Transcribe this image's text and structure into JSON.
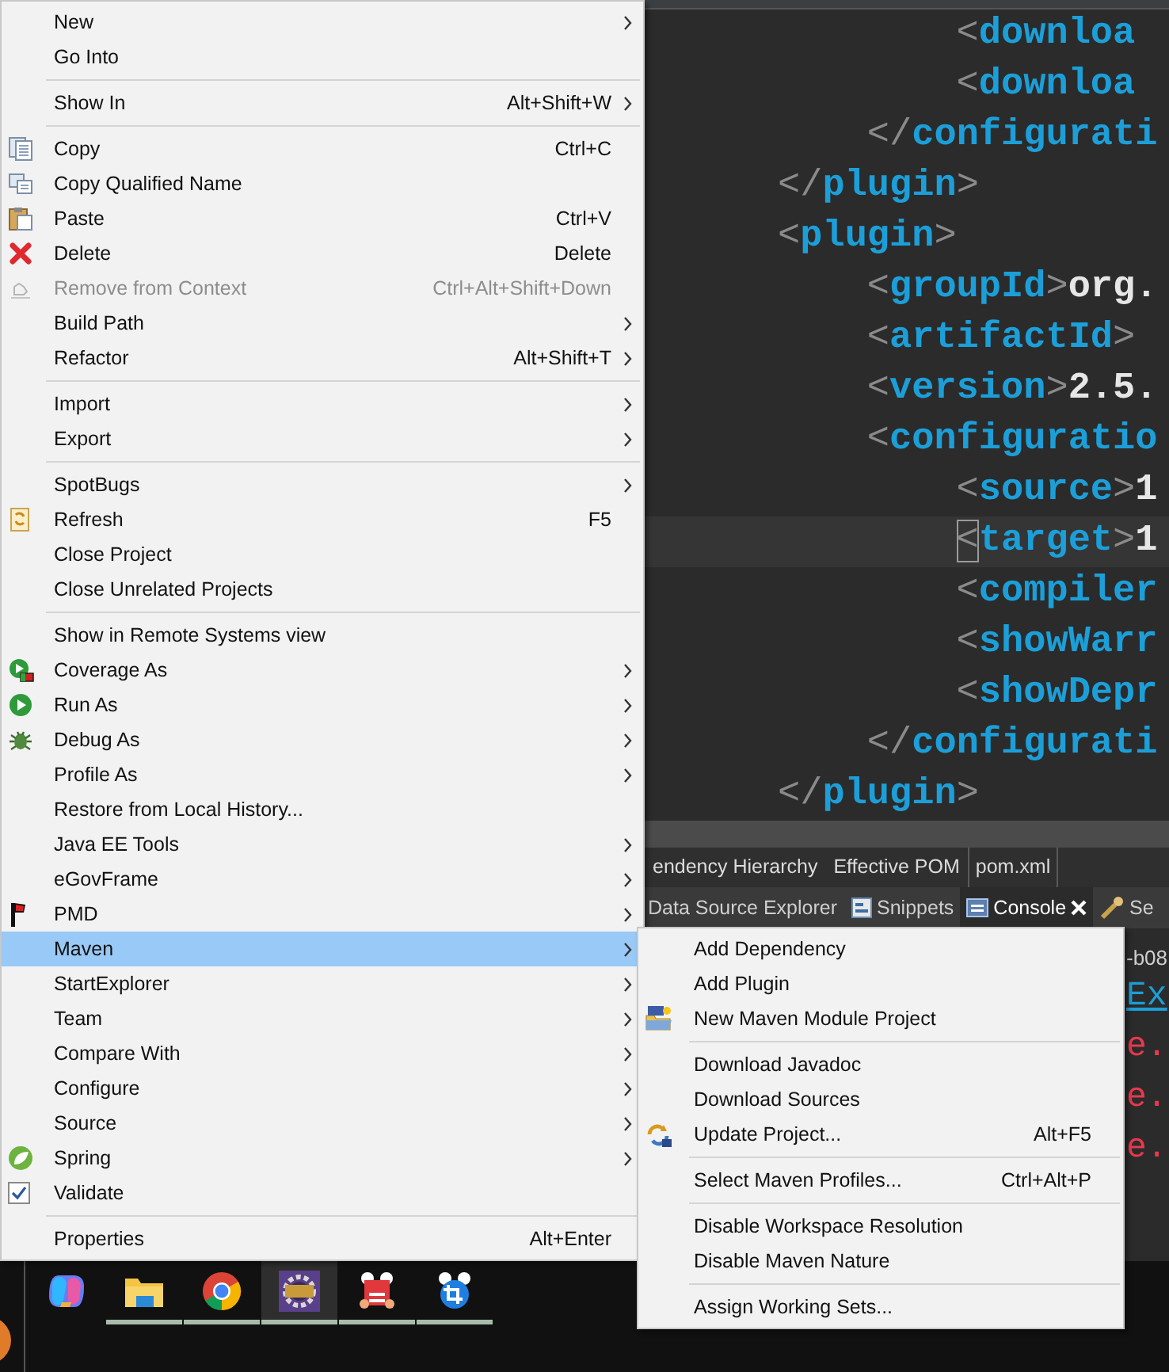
{
  "editor": {
    "lines": [
      {
        "text": "        <downloa",
        "current": false
      },
      {
        "text": "        <downloa",
        "current": false
      },
      {
        "text": "    </configurati",
        "current": false
      },
      {
        "text": "</plugin>",
        "current": false
      },
      {
        "text": "<plugin>",
        "current": false
      },
      {
        "text": "    <groupId>org.",
        "current": false
      },
      {
        "text": "    <artifactId>",
        "current": false
      },
      {
        "text": "    <version>2.5.",
        "current": false
      },
      {
        "text": "    <configuratio",
        "current": false
      },
      {
        "text": "        <source>1",
        "current": false
      },
      {
        "text": "        <target>1",
        "current": true
      },
      {
        "text": "        <compiler",
        "current": false
      },
      {
        "text": "        <showWarr",
        "current": false
      },
      {
        "text": "        <showDepr",
        "current": false
      },
      {
        "text": "    </configurati",
        "current": false
      },
      {
        "text": "</plugin>",
        "current": false
      }
    ]
  },
  "editor_tabs": [
    {
      "label": "endency Hierarchy",
      "selected": false
    },
    {
      "label": "Effective POM",
      "selected": false
    },
    {
      "label": "pom.xml",
      "selected": true
    }
  ],
  "views": [
    {
      "label": "Data Source Explorer",
      "selected": false
    },
    {
      "label": "Snippets",
      "selected": false
    },
    {
      "label": "Console",
      "selected": true
    },
    {
      "label": "Se",
      "selected": false
    }
  ],
  "console": {
    "lines": [
      {
        "text": "-b08",
        "kind": "plain"
      },
      {
        "text": "Ex",
        "kind": "link"
      },
      {
        "text": "e.",
        "kind": "error"
      },
      {
        "text": "e.",
        "kind": "error"
      },
      {
        "text": "e.",
        "kind": "error"
      }
    ]
  },
  "context_menu": {
    "items": [
      {
        "kind": "item",
        "label": "New",
        "submenu": true,
        "disabled": false,
        "selected": false
      },
      {
        "kind": "item",
        "label": "Go Into",
        "submenu": false,
        "disabled": false,
        "selected": false
      },
      {
        "kind": "separator"
      },
      {
        "kind": "item",
        "label": "Show In",
        "shortcut": "Alt+Shift+W",
        "submenu": true,
        "disabled": false,
        "selected": false
      },
      {
        "kind": "separator"
      },
      {
        "kind": "item",
        "label": "Copy",
        "shortcut": "Ctrl+C",
        "submenu": false,
        "disabled": false,
        "selected": false
      },
      {
        "kind": "item",
        "label": "Copy Qualified Name",
        "submenu": false,
        "disabled": false,
        "selected": false
      },
      {
        "kind": "item",
        "label": "Paste",
        "shortcut": "Ctrl+V",
        "submenu": false,
        "disabled": false,
        "selected": false
      },
      {
        "kind": "item",
        "label": "Delete",
        "shortcut": "Delete",
        "submenu": false,
        "disabled": false,
        "selected": false
      },
      {
        "kind": "item",
        "label": "Remove from Context",
        "shortcut": "Ctrl+Alt+Shift+Down",
        "submenu": false,
        "disabled": true,
        "selected": false
      },
      {
        "kind": "item",
        "label": "Build Path",
        "submenu": true,
        "disabled": false,
        "selected": false
      },
      {
        "kind": "item",
        "label": "Refactor",
        "shortcut": "Alt+Shift+T",
        "submenu": true,
        "disabled": false,
        "selected": false
      },
      {
        "kind": "separator"
      },
      {
        "kind": "item",
        "label": "Import",
        "submenu": true,
        "disabled": false,
        "selected": false
      },
      {
        "kind": "item",
        "label": "Export",
        "submenu": true,
        "disabled": false,
        "selected": false
      },
      {
        "kind": "separator"
      },
      {
        "kind": "item",
        "label": "SpotBugs",
        "submenu": true,
        "disabled": false,
        "selected": false
      },
      {
        "kind": "item",
        "label": "Refresh",
        "shortcut": "F5",
        "submenu": false,
        "disabled": false,
        "selected": false
      },
      {
        "kind": "item",
        "label": "Close Project",
        "submenu": false,
        "disabled": false,
        "selected": false
      },
      {
        "kind": "item",
        "label": "Close Unrelated Projects",
        "submenu": false,
        "disabled": false,
        "selected": false
      },
      {
        "kind": "separator"
      },
      {
        "kind": "item",
        "label": "Show in Remote Systems view",
        "submenu": false,
        "disabled": false,
        "selected": false
      },
      {
        "kind": "item",
        "label": "Coverage As",
        "submenu": true,
        "disabled": false,
        "selected": false
      },
      {
        "kind": "item",
        "label": "Run As",
        "submenu": true,
        "disabled": false,
        "selected": false
      },
      {
        "kind": "item",
        "label": "Debug As",
        "submenu": true,
        "disabled": false,
        "selected": false
      },
      {
        "kind": "item",
        "label": "Profile As",
        "submenu": true,
        "disabled": false,
        "selected": false
      },
      {
        "kind": "item",
        "label": "Restore from Local History...",
        "submenu": false,
        "disabled": false,
        "selected": false
      },
      {
        "kind": "item",
        "label": "Java EE Tools",
        "submenu": true,
        "disabled": false,
        "selected": false
      },
      {
        "kind": "item",
        "label": "eGovFrame",
        "submenu": true,
        "disabled": false,
        "selected": false
      },
      {
        "kind": "item",
        "label": "PMD",
        "submenu": true,
        "disabled": false,
        "selected": false
      },
      {
        "kind": "item",
        "label": "Maven",
        "submenu": true,
        "disabled": false,
        "selected": true
      },
      {
        "kind": "item",
        "label": "StartExplorer",
        "submenu": true,
        "disabled": false,
        "selected": false
      },
      {
        "kind": "item",
        "label": "Team",
        "submenu": true,
        "disabled": false,
        "selected": false
      },
      {
        "kind": "item",
        "label": "Compare With",
        "submenu": true,
        "disabled": false,
        "selected": false
      },
      {
        "kind": "item",
        "label": "Configure",
        "submenu": true,
        "disabled": false,
        "selected": false
      },
      {
        "kind": "item",
        "label": "Source",
        "submenu": true,
        "disabled": false,
        "selected": false
      },
      {
        "kind": "item",
        "label": "Spring",
        "submenu": true,
        "disabled": false,
        "selected": false
      },
      {
        "kind": "item",
        "label": "Validate",
        "submenu": false,
        "disabled": false,
        "selected": false
      },
      {
        "kind": "separator"
      },
      {
        "kind": "item",
        "label": "Properties",
        "shortcut": "Alt+Enter",
        "submenu": false,
        "disabled": false,
        "selected": false
      }
    ]
  },
  "submenu": {
    "items": [
      {
        "kind": "item",
        "label": "Add Dependency",
        "submenu": false,
        "disabled": false,
        "selected": false
      },
      {
        "kind": "item",
        "label": "Add Plugin",
        "submenu": false,
        "disabled": false,
        "selected": false
      },
      {
        "kind": "item",
        "label": "New Maven Module Project",
        "submenu": false,
        "disabled": false,
        "selected": false
      },
      {
        "kind": "separator"
      },
      {
        "kind": "item",
        "label": "Download Javadoc",
        "submenu": false,
        "disabled": false,
        "selected": false
      },
      {
        "kind": "item",
        "label": "Download Sources",
        "submenu": false,
        "disabled": false,
        "selected": false
      },
      {
        "kind": "item",
        "label": "Update Project...",
        "shortcut": "Alt+F5",
        "submenu": false,
        "disabled": false,
        "selected": false
      },
      {
        "kind": "separator"
      },
      {
        "kind": "item",
        "label": "Select Maven Profiles...",
        "shortcut": "Ctrl+Alt+P",
        "submenu": false,
        "disabled": false,
        "selected": false
      },
      {
        "kind": "separator"
      },
      {
        "kind": "item",
        "label": "Disable Workspace Resolution",
        "submenu": false,
        "disabled": false,
        "selected": false
      },
      {
        "kind": "item",
        "label": "Disable Maven Nature",
        "submenu": false,
        "disabled": false,
        "selected": false
      },
      {
        "kind": "separator"
      },
      {
        "kind": "item",
        "label": "Assign Working Sets...",
        "submenu": false,
        "disabled": false,
        "selected": false
      }
    ]
  },
  "taskbar": {
    "apps": [
      {
        "running": false,
        "selected": false
      },
      {
        "running": true,
        "selected": false
      },
      {
        "running": true,
        "selected": false
      },
      {
        "running": true,
        "selected": true
      },
      {
        "running": true,
        "selected": false
      },
      {
        "running": true,
        "selected": false
      }
    ]
  }
}
